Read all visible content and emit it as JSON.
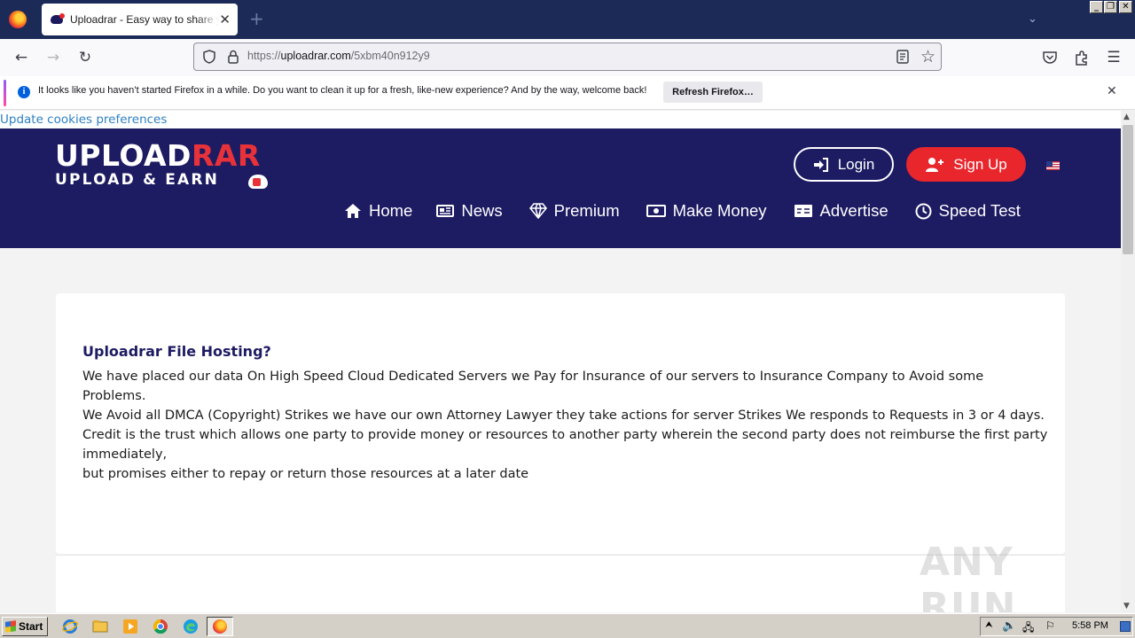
{
  "browser": {
    "tab_title": "Uploadrar - Easy way to share your files",
    "url_prefix": "https://",
    "url_host": "uploadrar.com",
    "url_path": "/5xbm40n912y9",
    "tab_close": "✕",
    "new_tab": "+"
  },
  "notification": {
    "text": "It looks like you haven’t started Firefox in a while. Do you want to clean it up for a fresh, like-new experience? And by the way, welcome back!",
    "button": "Refresh Firefox…",
    "info": "i"
  },
  "page": {
    "cookie_link": "Update cookies preferences",
    "logo": {
      "top_white": "UPL",
      "top_white2": "ADRAR",
      "top_red_o": "O",
      "bottom": "UPLOAD & EARN"
    },
    "login": "Login",
    "signup": "Sign Up",
    "nav": [
      "Home",
      "News",
      "Premium",
      "Make Money",
      "Advertise",
      "Speed Test"
    ],
    "content_title": "Uploadrar File Hosting?",
    "content_lines": [
      "We have placed our data On High Speed Cloud Dedicated Servers we Pay for Insurance of our servers to Insurance Company to Avoid some Problems.",
      "We Avoid all DMCA (Copyright) Strikes we have our own Attorney Lawyer they take actions for server Strikes We responds to Requests in 3 or 4 days.",
      "Credit is the trust which allows one party to provide money or resources to another party wherein the second party does not reimburse the first party immediately,",
      "but promises either to repay or return those resources at a later date"
    ],
    "watermark": "ANY RUN"
  },
  "taskbar": {
    "start": "Start",
    "clock": "5:58 PM"
  },
  "colors": {
    "header_bg": "#1d1b62",
    "brand_red": "#e8262c",
    "link_blue": "#2d7fc1"
  }
}
